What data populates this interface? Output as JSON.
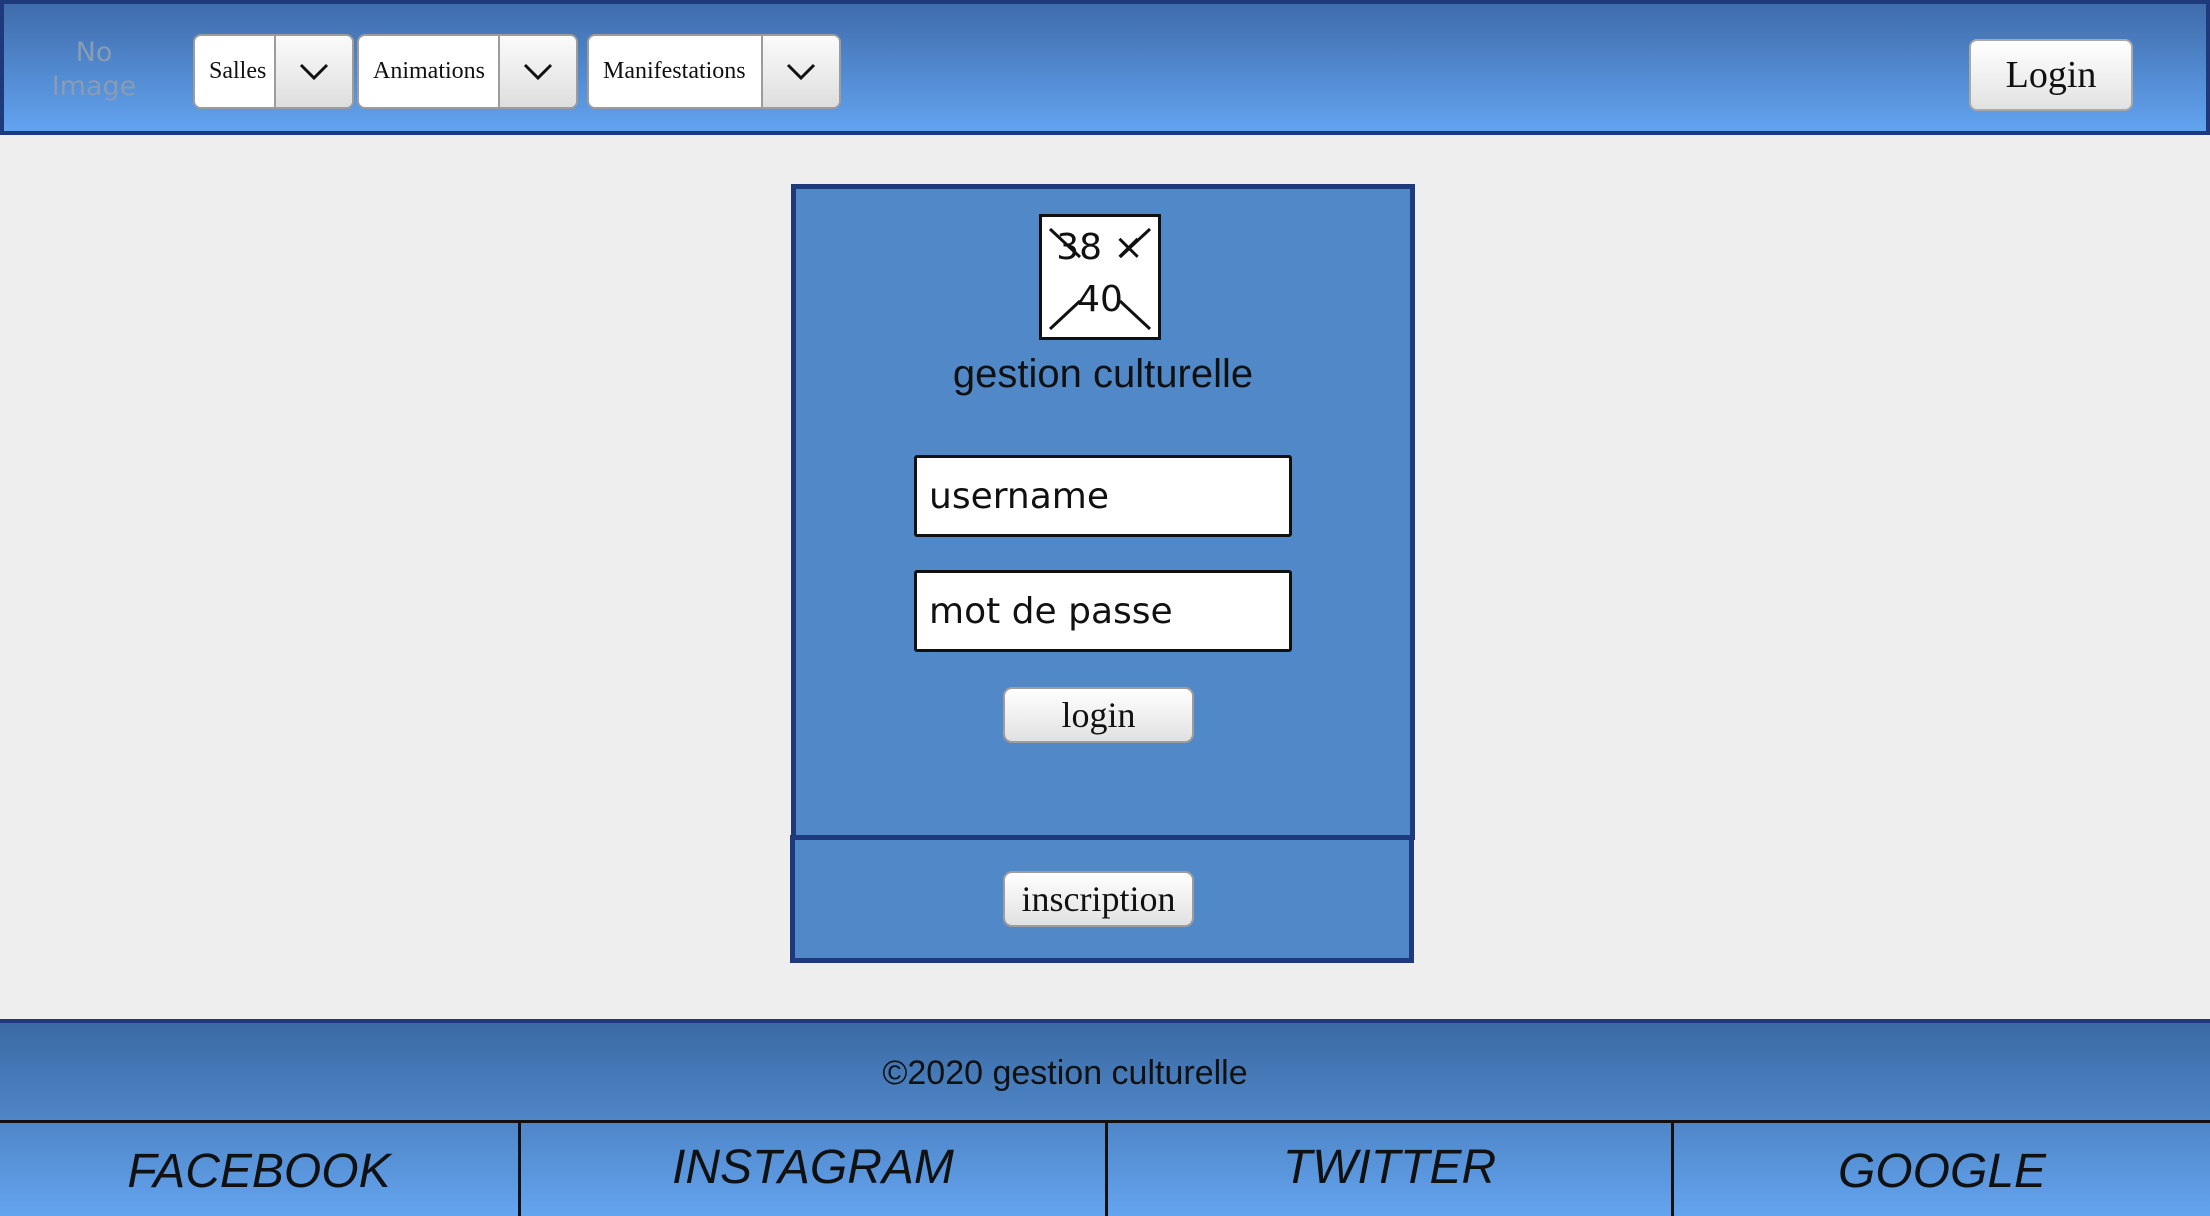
{
  "header": {
    "logo_text": "No Image",
    "menus": [
      {
        "label": "Salles"
      },
      {
        "label": "Animations"
      },
      {
        "label": "Manifestations"
      }
    ],
    "login_label": "Login"
  },
  "login_panel": {
    "avatar_line1": "38 ×",
    "avatar_line2": "40",
    "app_title": "gestion culturelle",
    "username_placeholder": "username",
    "password_placeholder": "mot de passe",
    "login_button": "login",
    "inscription_button": "inscription"
  },
  "footer": {
    "copyright": "©2020 gestion culturelle",
    "social_links": [
      "FACEBOOK",
      "INSTAGRAM",
      "TWITTER",
      "GOOGLE"
    ]
  },
  "colors": {
    "header_gradient_top": "#3f6cab",
    "header_gradient_bottom": "#62a3ef",
    "panel_bg": "#5189c8",
    "border_dark_blue": "#1f3a7c",
    "page_bg": "#eeeeee"
  },
  "icons": {
    "dropdown_arrow": "chevron-down-icon",
    "image_placeholder": "image-placeholder-icon"
  }
}
